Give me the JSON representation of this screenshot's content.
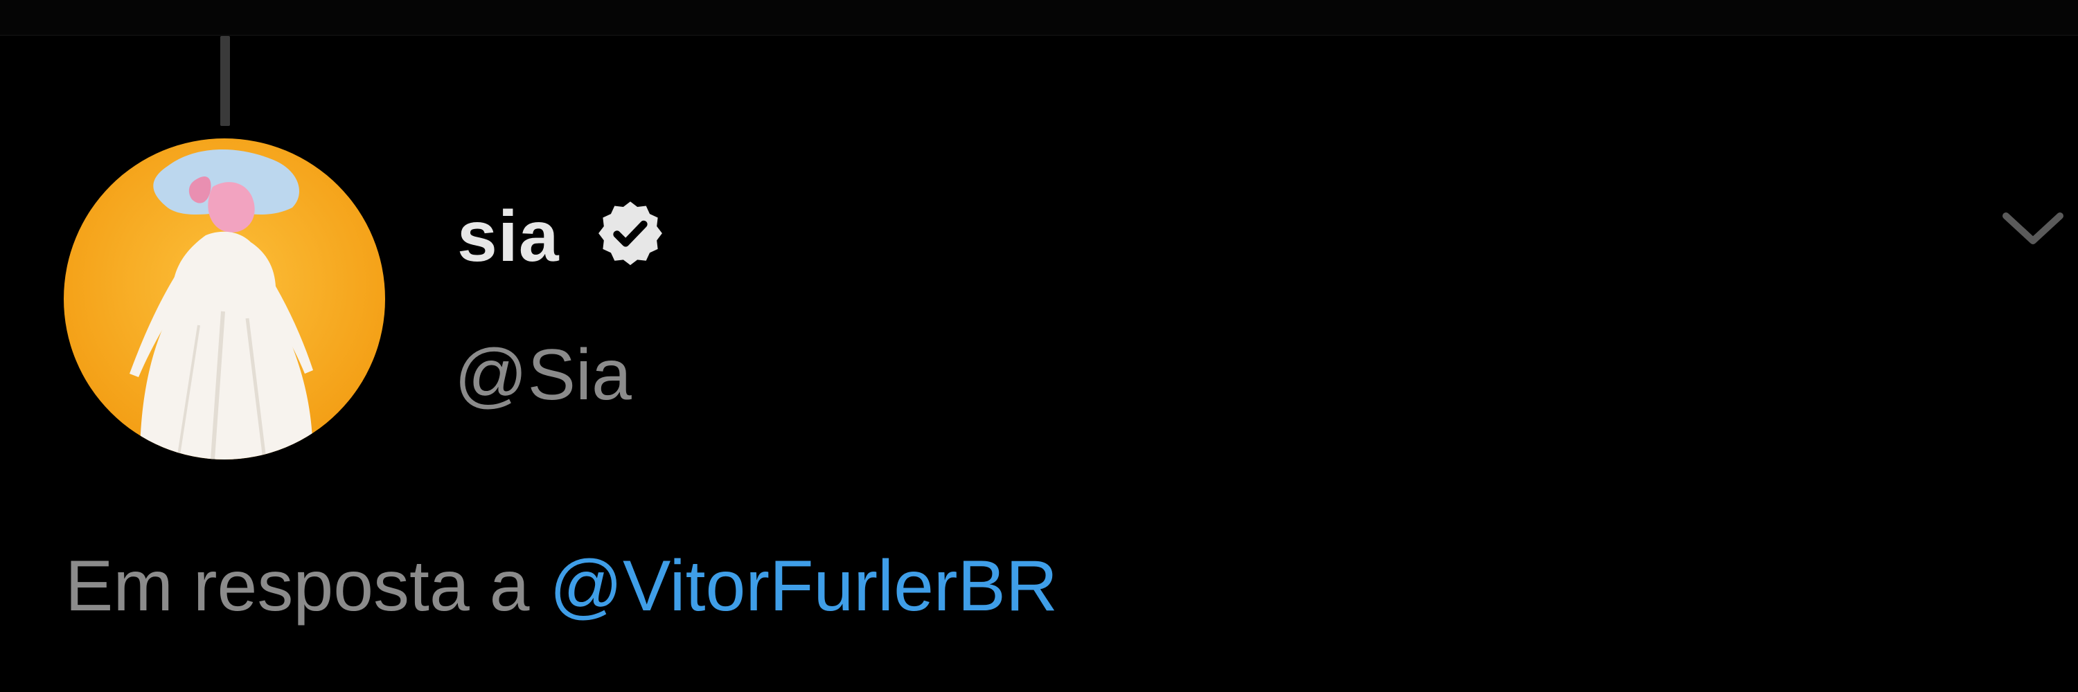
{
  "tweet": {
    "author": {
      "display_name": "sia",
      "handle": "@Sia",
      "verified": true,
      "avatar_icon": "profile-photo"
    },
    "reply": {
      "prefix": "Em resposta a",
      "mention": "@VitorFurlerBR"
    },
    "menu_icon": "chevron-down-icon"
  },
  "colors": {
    "background": "#000000",
    "primary_text": "#e7e7e7",
    "secondary_text": "#8b8b8b",
    "link": "#3f9ee8",
    "avatar_background": "#f5a623"
  }
}
